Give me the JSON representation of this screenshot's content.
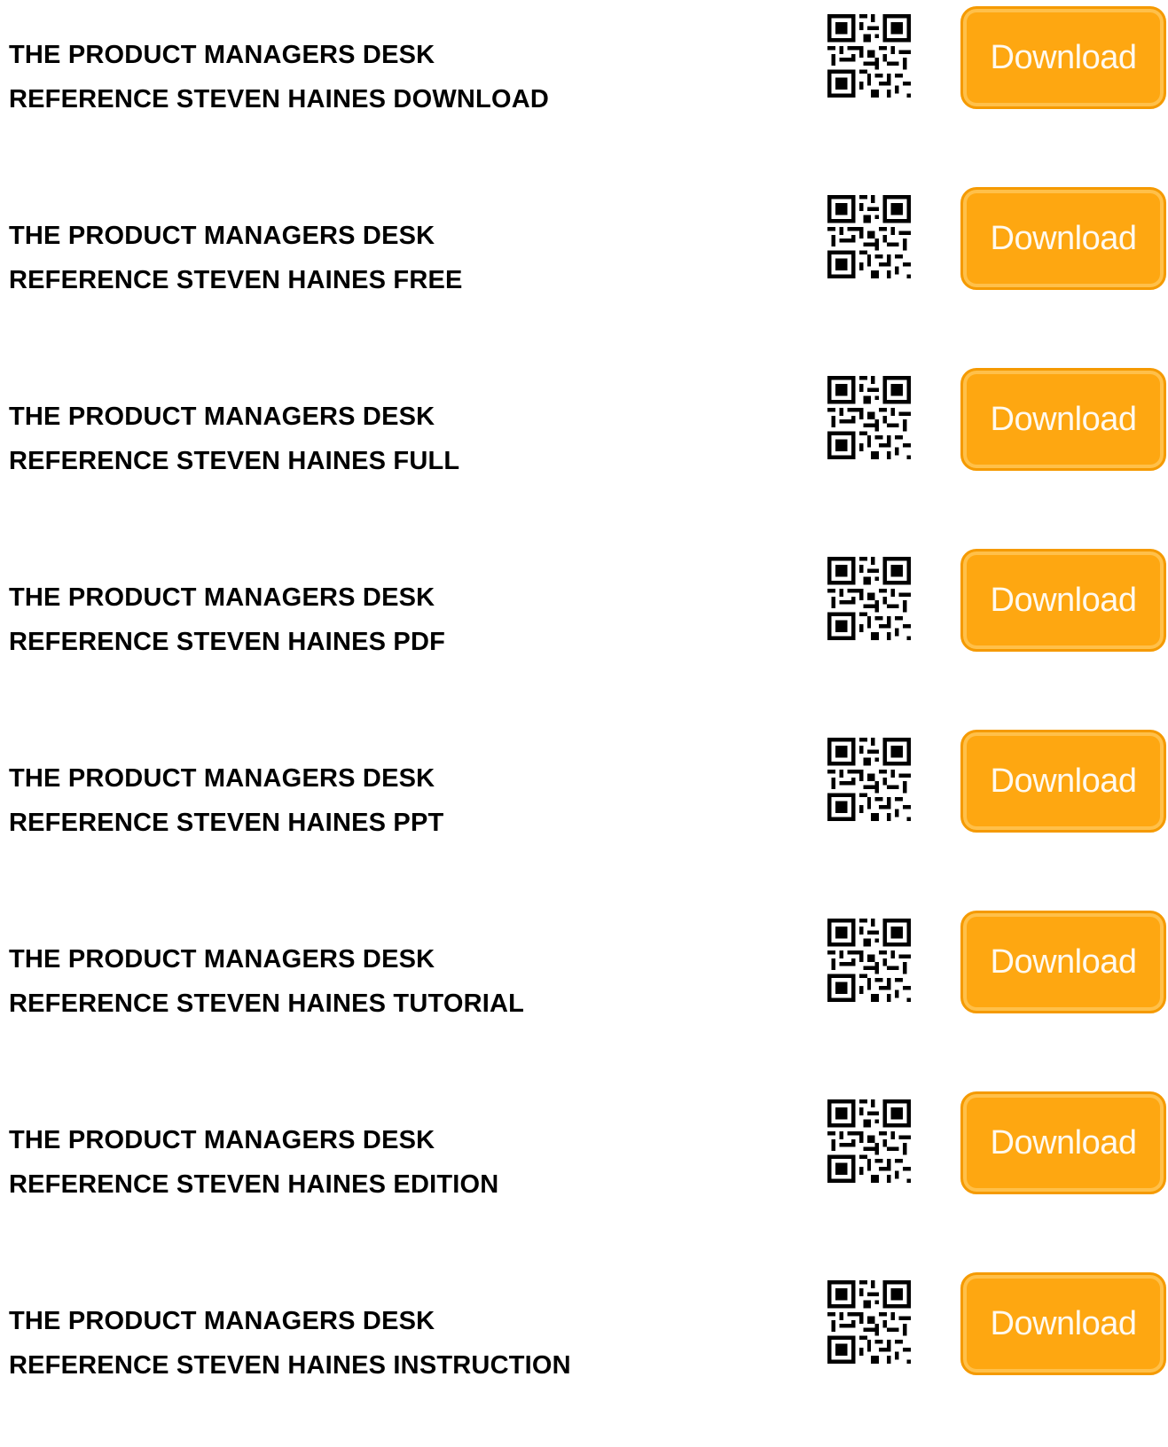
{
  "items": [
    {
      "title_line1": "THE PRODUCT MANAGERS DESK",
      "title_line2": "REFERENCE STEVEN HAINES DOWNLOAD",
      "button_label": "Download",
      "qr_icon": "qr-code-icon"
    },
    {
      "title_line1": "THE PRODUCT MANAGERS DESK",
      "title_line2": "REFERENCE STEVEN HAINES FREE",
      "button_label": "Download",
      "qr_icon": "qr-code-icon"
    },
    {
      "title_line1": "THE PRODUCT MANAGERS DESK",
      "title_line2": "REFERENCE STEVEN HAINES FULL",
      "button_label": "Download",
      "qr_icon": "qr-code-icon"
    },
    {
      "title_line1": "THE PRODUCT MANAGERS DESK",
      "title_line2": "REFERENCE STEVEN HAINES PDF",
      "button_label": "Download",
      "qr_icon": "qr-code-icon"
    },
    {
      "title_line1": "THE PRODUCT MANAGERS DESK",
      "title_line2": "REFERENCE STEVEN HAINES PPT",
      "button_label": "Download",
      "qr_icon": "qr-code-icon"
    },
    {
      "title_line1": "THE PRODUCT MANAGERS DESK",
      "title_line2": "REFERENCE STEVEN HAINES TUTORIAL",
      "button_label": "Download",
      "qr_icon": "qr-code-icon"
    },
    {
      "title_line1": "THE PRODUCT MANAGERS DESK",
      "title_line2": "REFERENCE STEVEN HAINES EDITION",
      "button_label": "Download",
      "qr_icon": "qr-code-icon"
    },
    {
      "title_line1": "THE PRODUCT MANAGERS DESK",
      "title_line2": "REFERENCE STEVEN HAINES INSTRUCTION",
      "button_label": "Download",
      "qr_icon": "qr-code-icon"
    }
  ],
  "colors": {
    "button_fill": "#fea711",
    "button_border": "#f59a00",
    "button_text": "#fff9ee"
  }
}
